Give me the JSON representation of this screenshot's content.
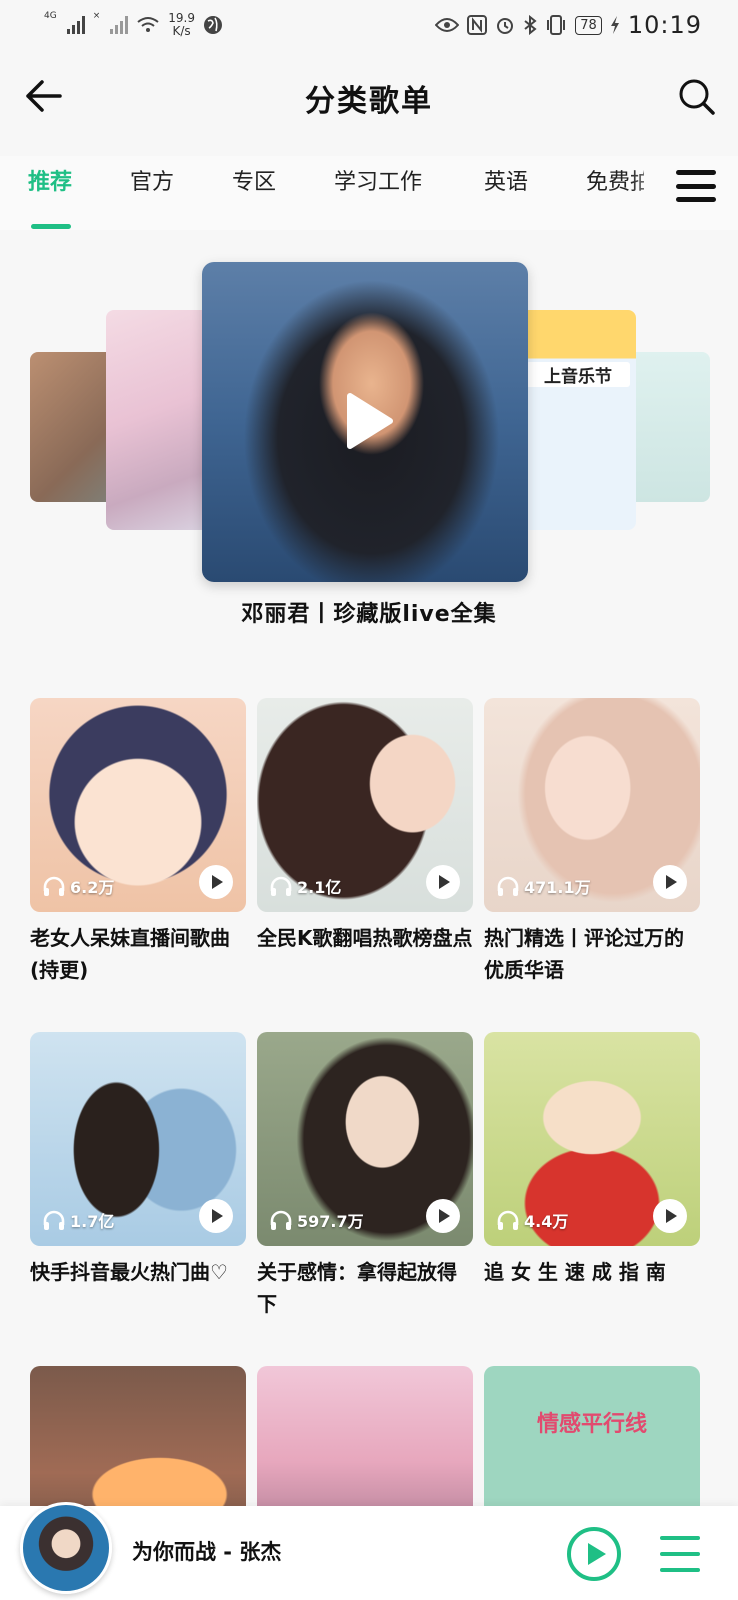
{
  "status_bar": {
    "network_tags": [
      "4G",
      "×"
    ],
    "speed_value": "19.9",
    "speed_unit": "K/s",
    "battery": "78",
    "time": "10:19"
  },
  "header": {
    "title": "分类歌单"
  },
  "tabs": [
    {
      "label": "推荐",
      "active": true
    },
    {
      "label": "官方",
      "active": false
    },
    {
      "label": "专区",
      "active": false
    },
    {
      "label": "学习工作",
      "active": false
    },
    {
      "label": "英语",
      "active": false
    },
    {
      "label": "免费拍",
      "active": false
    }
  ],
  "carousel": {
    "caption": "邓丽君丨珍藏版live全集",
    "side_banner_text": "上音乐节"
  },
  "playlists": [
    {
      "plays": "6.2万",
      "title": "老女人呆妹直播间歌曲(持更)"
    },
    {
      "plays": "2.1亿",
      "title": "全民K歌翻唱热歌榜盘点"
    },
    {
      "plays": "471.1万",
      "title": "热门精选丨评论过万的优质华语"
    },
    {
      "plays": "1.7亿",
      "title": "快手抖音最火热门曲♡"
    },
    {
      "plays": "597.7万",
      "title": "关于感情：拿得起放得下"
    },
    {
      "plays": "4.4万",
      "title": "追 女 生 速 成 指 南"
    },
    {
      "plays": "",
      "title": ""
    },
    {
      "plays": "",
      "title": ""
    },
    {
      "plays": "",
      "title": "",
      "cover_text": "情感平行线"
    }
  ],
  "player": {
    "song": "为你而战 - 张杰"
  },
  "colors": {
    "accent": "#1fbf85"
  },
  "icons": {
    "back": "arrow-left-icon",
    "search": "search-icon",
    "menu": "hamburger-menu-icon",
    "play": "play-icon",
    "headphones": "headphones-icon",
    "playlist": "playlist-icon"
  }
}
